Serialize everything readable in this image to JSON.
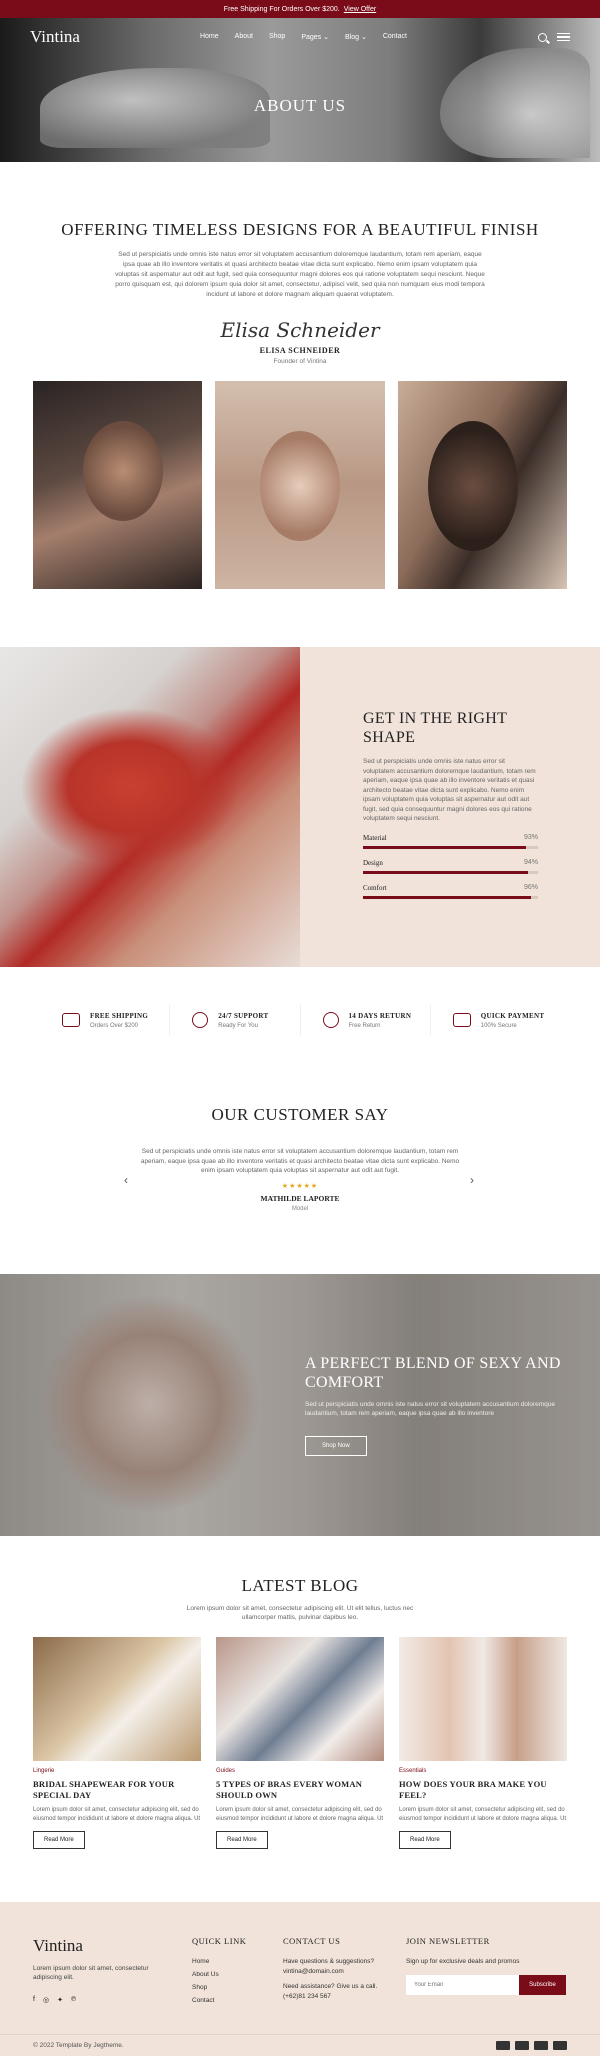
{
  "topbar": {
    "text": "Free Shipping For Orders Over $200.",
    "link": "View Offer"
  },
  "nav": {
    "logo": "Vintina",
    "items": [
      "Home",
      "About",
      "Shop",
      "Pages ⌄",
      "Blog ⌄",
      "Contact"
    ]
  },
  "hero": {
    "title": "ABOUT US"
  },
  "about": {
    "title": "OFFERING TIMELESS DESIGNS FOR A BEAUTIFUL FINISH",
    "text": "Sed ut perspiciatis unde omnis iste natus error sit voluptatem accusantium doloremque laudantium, totam rem aperiam, eaque ipsa quae ab illo inventore veritatis et quasi architecto beatae vitae dicta sunt explicabo. Nemo enim ipsam voluptatem quia voluptas sit aspernatur aut odit aut fugit, sed quia consequuntur magni dolores eos qui ratione voluptatem sequi nesciunt. Neque porro quisquam est, qui dolorem ipsum quia dolor sit amet, consectetur, adipisci velit, sed quia non numquam eius modi tempora incidunt ut labore et dolore magnam aliquam quaerat voluptatem.",
    "signature": "Elisa Schneider",
    "name": "ELISA SCHNEIDER",
    "role": "Founder of Vintina"
  },
  "shape": {
    "title": "GET IN THE RIGHT SHAPE",
    "text": "Sed ut perspiciatis unde omnis iste natus error sit voluptatem accusantium doloremque laudantium, totam rem aperiam, eaque ipsa quae ab illo inventore veritatis et quasi architecto beatae vitae dicta sunt explicabo. Nemo enim ipsam voluptatem quia voluptas sit aspernatur aut odit aut fugit, sed quia consequuntur magni dolores eos qui ratione voluptatem sequi nesciunt.",
    "skills": [
      {
        "label": "Material",
        "value": "93%",
        "pct": 93
      },
      {
        "label": "Design",
        "value": "94%",
        "pct": 94
      },
      {
        "label": "Comfort",
        "value": "96%",
        "pct": 96
      }
    ]
  },
  "features": [
    {
      "title": "FREE SHIPPING",
      "sub": "Orders Over $200"
    },
    {
      "title": "24/7 SUPPORT",
      "sub": "Ready For You"
    },
    {
      "title": "14 DAYS RETURN",
      "sub": "Free Return"
    },
    {
      "title": "QUICK PAYMENT",
      "sub": "100% Secure"
    }
  ],
  "testimonial": {
    "title": "OUR CUSTOMER SAY",
    "text": "Sed ut perspiciatis unde omnis iste natus error sit voluptatem accusantium doloremque laudantium, totam rem aperiam, eaque ipsa quae ab illo inventore veritatis et quasi architecto beatae vitae dicta sunt explicabo. Nemo enim ipsam voluptatem quia voluptas sit aspernatur aut odit aut fugit.",
    "stars": "★★★★★",
    "name": "MATHILDE LAPORTE",
    "role": "Model",
    "prev": "‹",
    "next": "›"
  },
  "banner": {
    "title": "A PERFECT BLEND OF SEXY AND COMFORT",
    "text": "Sed ut perspiciatis unde omnis iste natus error sit voluptatem accusantium doloremque laudantium, totam rem aperiam, eaque ipsa quae ab illo inventore",
    "button": "Shop Now"
  },
  "blog": {
    "title": "LATEST BLOG",
    "sub": "Lorem ipsum dolor sit amet, consectetur adipiscing elit. Ut elit tellus, luctus nec ullamcorper mattis, pulvinar dapibus leo.",
    "posts": [
      {
        "cat": "Lingerie",
        "title": "BRIDAL SHAPEWEAR FOR YOUR SPECIAL DAY",
        "text": "Lorem ipsum dolor sit amet, consectetur adipiscing elit, sed do eiusmod tempor incididunt ut labore et dolore magna aliqua. Ut",
        "button": "Read More"
      },
      {
        "cat": "Guides",
        "title": "5 TYPES OF BRAS EVERY WOMAN SHOULD OWN",
        "text": "Lorem ipsum dolor sit amet, consectetur adipiscing elit, sed do eiusmod tempor incididunt ut labore et dolore magna aliqua. Ut",
        "button": "Read More"
      },
      {
        "cat": "Essentials",
        "title": "HOW DOES YOUR BRA MAKE YOU FEEL?",
        "text": "Lorem ipsum dolor sit amet, consectetur adipiscing elit, sed do eiusmod tempor incididunt ut labore et dolore magna aliqua. Ut",
        "button": "Read More"
      }
    ]
  },
  "footer": {
    "logo": "Vintina",
    "text": "Lorem ipsum dolor sit amet, consectetur adipiscing elit.",
    "social": [
      "f",
      "◎",
      "✦",
      "℗"
    ],
    "quick_title": "QUICK LINK",
    "quick_links": [
      "Home",
      "About Us",
      "Shop",
      "Contact"
    ],
    "contact_title": "CONTACT US",
    "contact_q": "Have questions & suggestions?",
    "email": "vintina@domain.com",
    "assist": "Need assistance? Give us a call.",
    "phone": "(+62)81 234 567",
    "news_title": "JOIN NEWSLETTER",
    "news_text": "Sign up for exclusive deals and promos",
    "news_placeholder": "Your Email",
    "news_button": "Subscribe",
    "copyright": "© 2022 Template By Jegtheme."
  },
  "colors": {
    "accent": "#7a0c19",
    "panel": "#f1e3d9",
    "star": "#e0a81e"
  }
}
